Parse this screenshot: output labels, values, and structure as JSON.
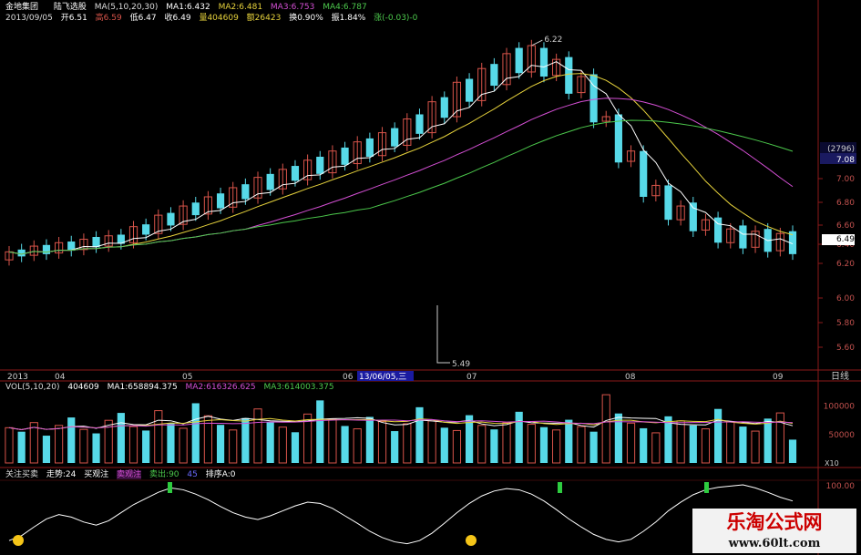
{
  "header": {
    "app_name": "金地集团",
    "indicator_name": "陆飞选股",
    "ma_params": "MA(5,10,20,30)",
    "ma1": "MA1:6.432",
    "ma2": "MA2:6.481",
    "ma3": "MA3:6.753",
    "ma4": "MA4:6.787",
    "date": "2013/09/05",
    "open": "开6.51",
    "high": "高6.59",
    "low": "低6.47",
    "close": "收6.49",
    "volume": "量404609",
    "amount": "额26423",
    "turnover": "换0.90%",
    "amplitude": "振1.84%",
    "change": "涨(-0.03)-0"
  },
  "price_panel": {
    "high_marker": "6.22",
    "low_marker": "5.49",
    "ticks": [
      "6.60",
      "6.40",
      "6.20",
      "6.00",
      "5.80",
      "5.60",
      "6.80",
      "7.00"
    ],
    "right_boxes": {
      "top": "(2796)",
      "price": "7.08"
    },
    "last_price": "6.49"
  },
  "date_axis": {
    "labels": [
      "2013",
      "04",
      "05",
      "06",
      "13/06/05,三",
      "07",
      "08",
      "09"
    ],
    "period": "日线"
  },
  "vol_panel": {
    "title": "VOL(5,10,20)",
    "value": "404609",
    "ma1": "MA1:658894.375",
    "ma2": "MA2:616326.625",
    "ma3": "MA3:614003.375",
    "ticks": [
      "100000",
      "50000"
    ],
    "unit": "X10"
  },
  "ind_panel": {
    "label1": "关注买卖",
    "trend": "走势:24",
    "buy": "买观注",
    "sell_watch": "卖观注",
    "sell": "卖出:90",
    "n45": "45",
    "rank": "排序A:0",
    "tick": "100.00"
  },
  "watermark": {
    "line1": "乐淘公式网",
    "line2": "www.60lt.com"
  },
  "colors": {
    "up": "#d8544a",
    "down": "#57d9e8",
    "ma5": "#ffffff",
    "ma10": "#e6d23c",
    "ma20": "#d44fd4",
    "ma30": "#4cc94c"
  },
  "chart_data": [
    {
      "type": "candlestick",
      "title": "陆飞选股",
      "x_labels": [
        "2013",
        "04",
        "05",
        "06",
        "07",
        "08",
        "09"
      ],
      "y_ticks": [
        5.6,
        5.8,
        6.0,
        6.2,
        6.4,
        6.6,
        6.8,
        7.0
      ],
      "last": {
        "open": 6.51,
        "high": 6.59,
        "low": 6.47,
        "close": 6.49
      },
      "high_marker": 6.22,
      "low_marker": 5.49,
      "candles": [
        [
          6.35,
          6.42
        ],
        [
          6.44,
          6.38
        ],
        [
          6.39,
          6.47
        ],
        [
          6.48,
          6.4
        ],
        [
          6.41,
          6.5
        ],
        [
          6.51,
          6.43
        ],
        [
          6.44,
          6.53
        ],
        [
          6.55,
          6.46
        ],
        [
          6.47,
          6.56
        ],
        [
          6.57,
          6.49
        ],
        [
          6.5,
          6.64
        ],
        [
          6.66,
          6.57
        ],
        [
          6.58,
          6.74
        ],
        [
          6.76,
          6.65
        ],
        [
          6.66,
          6.82
        ],
        [
          6.85,
          6.74
        ],
        [
          6.75,
          6.9
        ],
        [
          6.93,
          6.8
        ],
        [
          6.81,
          6.98
        ],
        [
          7.01,
          6.88
        ],
        [
          6.89,
          7.07
        ],
        [
          7.1,
          6.96
        ],
        [
          6.97,
          7.14
        ],
        [
          7.17,
          7.04
        ],
        [
          7.05,
          7.22
        ],
        [
          7.25,
          7.1
        ],
        [
          7.11,
          7.3
        ],
        [
          7.33,
          7.18
        ],
        [
          7.19,
          7.38
        ],
        [
          7.41,
          7.25
        ],
        [
          7.26,
          7.46
        ],
        [
          7.5,
          7.34
        ],
        [
          7.35,
          7.58
        ],
        [
          7.62,
          7.45
        ],
        [
          7.46,
          7.73
        ],
        [
          7.77,
          7.59
        ],
        [
          7.6,
          7.9
        ],
        [
          7.93,
          7.73
        ],
        [
          7.74,
          8.02
        ],
        [
          8.06,
          7.87
        ],
        [
          7.88,
          8.15
        ],
        [
          8.2,
          7.98
        ],
        [
          7.99,
          8.22
        ],
        [
          8.2,
          7.95
        ],
        [
          7.96,
          8.1
        ],
        [
          8.12,
          7.8
        ],
        [
          7.81,
          7.95
        ],
        [
          7.97,
          7.55
        ],
        [
          7.56,
          7.6
        ],
        [
          7.62,
          7.2
        ],
        [
          7.21,
          7.3
        ],
        [
          7.3,
          6.9
        ],
        [
          6.91,
          7.0
        ],
        [
          7.0,
          6.7
        ],
        [
          6.7,
          6.82
        ],
        [
          6.85,
          6.6
        ],
        [
          6.61,
          6.7
        ],
        [
          6.72,
          6.5
        ],
        [
          6.5,
          6.62
        ],
        [
          6.65,
          6.45
        ],
        [
          6.46,
          6.6
        ],
        [
          6.62,
          6.42
        ],
        [
          6.43,
          6.58
        ],
        [
          6.6,
          6.4
        ]
      ],
      "volume": [
        62000,
        55000,
        71000,
        48000,
        66000,
        80000,
        59000,
        52000,
        75000,
        88000,
        64000,
        57000,
        92000,
        70000,
        61000,
        105000,
        83000,
        67000,
        58000,
        79000,
        95000,
        72000,
        63000,
        54000,
        86000,
        110000,
        77000,
        65000,
        60000,
        81000,
        73000,
        56000,
        69000,
        98000,
        74000,
        62000,
        57000,
        84000,
        66000,
        59000,
        71000,
        90000,
        68000,
        63000,
        58000,
        76000,
        64000,
        55000,
        120000,
        87000,
        70000,
        61000,
        53000,
        82000,
        74000,
        66000,
        60000,
        95000,
        72000,
        64000,
        56000,
        78000,
        88000,
        41000
      ],
      "indicator": [
        10,
        18,
        32,
        45,
        52,
        48,
        40,
        35,
        42,
        55,
        68,
        78,
        88,
        95,
        92,
        85,
        76,
        65,
        55,
        48,
        44,
        50,
        58,
        66,
        72,
        70,
        62,
        50,
        38,
        25,
        15,
        8,
        5,
        10,
        22,
        38,
        55,
        70,
        82,
        90,
        94,
        92,
        85,
        74,
        60,
        45,
        32,
        20,
        12,
        8,
        12,
        25,
        40,
        58,
        72,
        84,
        92,
        96,
        98,
        100,
        95,
        88,
        80,
        74
      ]
    },
    {
      "type": "bar",
      "title": "VOL(5,10,20)",
      "y_ticks": [
        50000,
        100000
      ],
      "current": 404609,
      "ma": {
        "MA1": 658894.375,
        "MA2": 616326.625,
        "MA3": 614003.375
      }
    }
  ]
}
